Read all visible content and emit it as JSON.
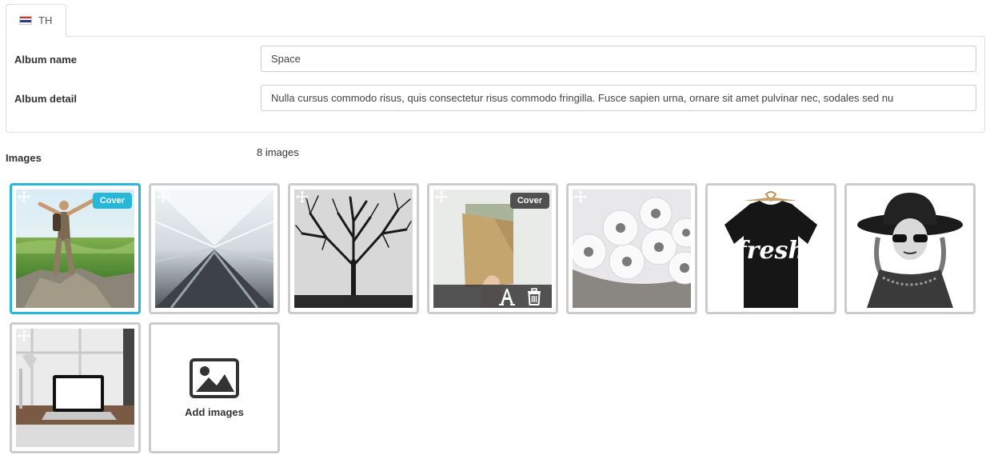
{
  "tabs": [
    {
      "label": "TH",
      "flag": "thailand-flag"
    }
  ],
  "form": {
    "album_name_label": "Album name",
    "album_name_value": "Space",
    "album_detail_label": "Album detail",
    "album_detail_value": "Nulla cursus commodo risus, quis consectetur risus commodo fringilla. Fusce sapien urna, ornare sit amet pulvinar nec, sodales sed nu"
  },
  "images": {
    "label": "Images",
    "count_text": "8 images",
    "items": [
      {
        "subject": "hiker on cliff",
        "cover_badge": "Cover",
        "is_cover": true
      },
      {
        "subject": "motion blur corridor"
      },
      {
        "subject": "bare tree"
      },
      {
        "subject": "leather wallet",
        "cover_badge": "Cover",
        "show_toolbar": true
      },
      {
        "subject": "toilet paper rolls"
      },
      {
        "subject": "fresh t-shirt",
        "print": "fresh"
      },
      {
        "subject": "woman in hat"
      },
      {
        "subject": "laptop on desk"
      }
    ],
    "add_label": "Add images"
  },
  "colors": {
    "accent": "#27b7d8",
    "border": "#cccccc",
    "badge_dark": "#505050"
  }
}
